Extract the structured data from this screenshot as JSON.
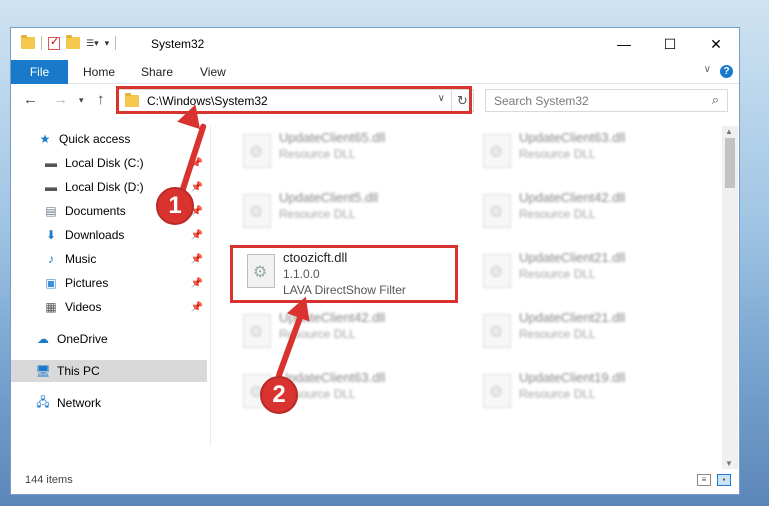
{
  "window": {
    "title": "System32"
  },
  "ribbon": {
    "tabs": [
      "File",
      "Home",
      "Share",
      "View"
    ]
  },
  "address": {
    "path": "C:\\Windows\\System32"
  },
  "search": {
    "placeholder": "Search System32"
  },
  "sidebar": {
    "items": [
      {
        "label": "Quick access",
        "icon": "star-icon",
        "pinned": false
      },
      {
        "label": "Local Disk (C:)",
        "icon": "drive-icon",
        "pinned": true
      },
      {
        "label": "Local Disk (D:)",
        "icon": "drive-icon",
        "pinned": true
      },
      {
        "label": "Documents",
        "icon": "documents-icon",
        "pinned": true
      },
      {
        "label": "Downloads",
        "icon": "download-icon",
        "pinned": true
      },
      {
        "label": "Music",
        "icon": "music-icon",
        "pinned": true
      },
      {
        "label": "Pictures",
        "icon": "pictures-icon",
        "pinned": true
      },
      {
        "label": "Videos",
        "icon": "videos-icon",
        "pinned": true
      },
      {
        "label": "OneDrive",
        "icon": "cloud-icon",
        "pinned": false
      },
      {
        "label": "This PC",
        "icon": "computer-icon",
        "pinned": false
      },
      {
        "label": "Network",
        "icon": "network-icon",
        "pinned": false
      }
    ]
  },
  "files": {
    "left": [
      {
        "name": "UpdateClient65.dll",
        "type": "Resource DLL"
      },
      {
        "name": "UpdateClient5.dll",
        "type": "Resource DLL"
      },
      {
        "name": "ctoozicft.dll",
        "version": "1.1.0.0",
        "type": "LAVA DirectShow Filter"
      },
      {
        "name": "UpdateClient42.dll",
        "type": "Resource DLL"
      },
      {
        "name": "UpdateClient63.dll",
        "type": "Resource DLL"
      }
    ],
    "right": [
      {
        "name": "UpdateClient63.dll",
        "type": "Resource DLL"
      },
      {
        "name": "UpdateClient42.dll",
        "type": "Resource DLL"
      },
      {
        "name": "UpdateClient21.dll",
        "type": "Resource DLL"
      },
      {
        "name": "UpdateClient21.dll",
        "type": "Resource DLL"
      },
      {
        "name": "UpdateClient19.dll",
        "type": "Resource DLL"
      }
    ]
  },
  "status": {
    "item_count": "144 items"
  },
  "annotations": {
    "step1": "1",
    "step2": "2"
  },
  "colors": {
    "accent": "#1979ca",
    "highlight": "#d9332f"
  }
}
